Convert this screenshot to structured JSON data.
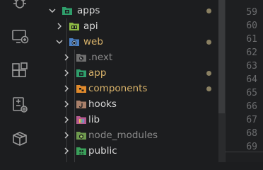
{
  "colors": {
    "accent_folder": "#2f9e6b",
    "modified_dot": "#8a8062",
    "text_default": "#d7d7d7",
    "text_ignored": "#8b8b8b",
    "text_modified": "#d9b36a"
  },
  "activity_bar": {
    "items": [
      {
        "icon": "debug-icon"
      },
      {
        "icon": "remote-explorer-icon"
      },
      {
        "icon": "extensions-icon"
      },
      {
        "icon": "testing-icon"
      },
      {
        "icon": "package-icon"
      }
    ]
  },
  "explorer": {
    "rows": [
      {
        "label": "apps",
        "icon": "apps-folder-icon",
        "expanded": true,
        "modified": true,
        "style": "default"
      },
      {
        "label": "api",
        "icon": "api-folder-icon",
        "expanded": false,
        "modified": false,
        "style": "default"
      },
      {
        "label": "web",
        "icon": "web-folder-icon",
        "expanded": true,
        "modified": true,
        "style": "modified"
      },
      {
        "label": ".next",
        "icon": "next-folder-icon",
        "expanded": false,
        "modified": false,
        "style": "ignored"
      },
      {
        "label": "app",
        "icon": "app-folder-icon",
        "expanded": false,
        "modified": true,
        "style": "modified"
      },
      {
        "label": "components",
        "icon": "components-folder-icon",
        "expanded": false,
        "modified": true,
        "style": "modified"
      },
      {
        "label": "hooks",
        "icon": "hooks-folder-icon",
        "expanded": false,
        "modified": false,
        "style": "default"
      },
      {
        "label": "lib",
        "icon": "lib-folder-icon",
        "expanded": false,
        "modified": false,
        "style": "default"
      },
      {
        "label": "node_modules",
        "icon": "node-modules-folder-icon",
        "expanded": false,
        "modified": false,
        "style": "ignored"
      },
      {
        "label": "public",
        "icon": "public-folder-icon",
        "expanded": false,
        "modified": false,
        "style": "default"
      }
    ]
  },
  "editor": {
    "line_numbers": [
      "59",
      "60",
      "61",
      "62",
      "63",
      "64",
      "65",
      "66",
      "67",
      "68",
      "69"
    ]
  }
}
